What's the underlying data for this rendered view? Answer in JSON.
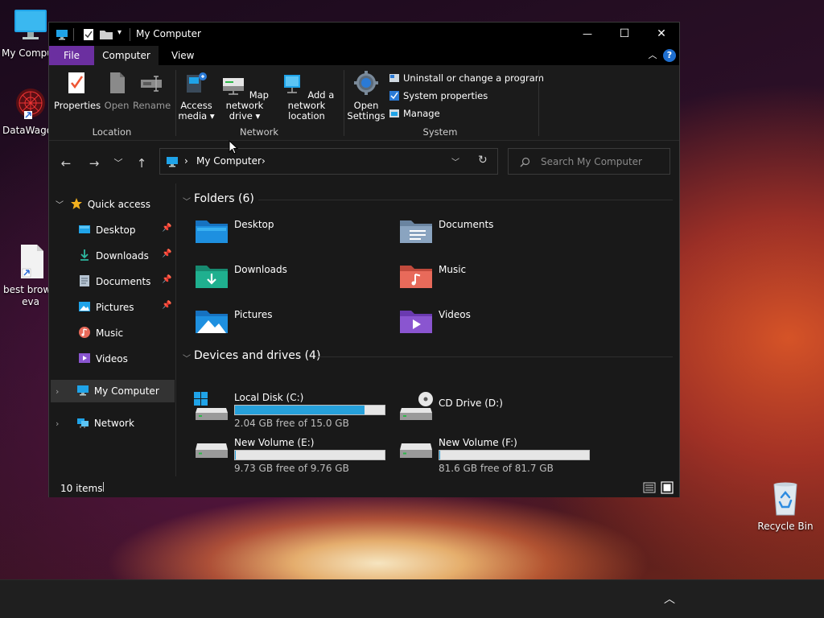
{
  "desktop": {
    "icons": [
      {
        "label": "My Compu",
        "icon": "computer-icon"
      },
      {
        "label": "DataWagon",
        "icon": "datawagon-icon"
      },
      {
        "label": "best brows",
        "label2": "eva",
        "icon": "file-icon"
      },
      {
        "label": "Recycle Bin",
        "icon": "recycle-bin-icon"
      }
    ]
  },
  "window": {
    "title": "My Computer",
    "minimize": "—",
    "maximize": "☐",
    "close": "✕"
  },
  "ribbon": {
    "tabs": {
      "file": "File",
      "computer": "Computer",
      "view": "View"
    },
    "help": "?",
    "location": {
      "label": "Location",
      "properties": "Properties",
      "open": "Open",
      "rename": "Rename"
    },
    "network": {
      "label": "Network",
      "access_media_1": "Access",
      "access_media_2": "media ▾",
      "map_drive_1": "Map network",
      "map_drive_2": "drive ▾",
      "add_location_1": "Add a network",
      "add_location_2": "location"
    },
    "system": {
      "label": "System",
      "open_settings_1": "Open",
      "open_settings_2": "Settings",
      "uninstall": "Uninstall or change a program",
      "system_properties": "System properties",
      "manage": "Manage"
    }
  },
  "address": {
    "crumb": "My Computer",
    "search_placeholder": "Search My Computer"
  },
  "sidebar": {
    "quick_access": "Quick access",
    "items": [
      {
        "label": "Desktop",
        "pinned": true
      },
      {
        "label": "Downloads",
        "pinned": true
      },
      {
        "label": "Documents",
        "pinned": true
      },
      {
        "label": "Pictures",
        "pinned": true
      },
      {
        "label": "Music",
        "pinned": false
      },
      {
        "label": "Videos",
        "pinned": false
      }
    ],
    "my_computer": "My Computer",
    "network": "Network"
  },
  "content": {
    "folders_header": "Folders (6)",
    "folders": [
      {
        "label": "Desktop",
        "color": "#1e90e0"
      },
      {
        "label": "Documents",
        "color": "#8aa4c0"
      },
      {
        "label": "Downloads",
        "color": "#1fb08f"
      },
      {
        "label": "Music",
        "color": "#e86a5a"
      },
      {
        "label": "Pictures",
        "color": "#1e90e0"
      },
      {
        "label": "Videos",
        "color": "#8a55d0"
      }
    ],
    "drives_header": "Devices and drives (4)",
    "drives": [
      {
        "name": "Local Disk (C:)",
        "free": "2.04 GB free of 15.0 GB",
        "used_fraction": 0.864
      },
      {
        "name": "CD Drive (D:)",
        "free": "",
        "used_fraction": null
      },
      {
        "name": "New Volume (E:)",
        "free": "9.73 GB free of 9.76 GB",
        "used_fraction": 0.003
      },
      {
        "name": "New Volume (F:)",
        "free": "81.6 GB free of 81.7 GB",
        "used_fraction": 0.001
      }
    ]
  },
  "status": {
    "items": "10 items"
  },
  "taskbar": {
    "chevron": "︿"
  }
}
